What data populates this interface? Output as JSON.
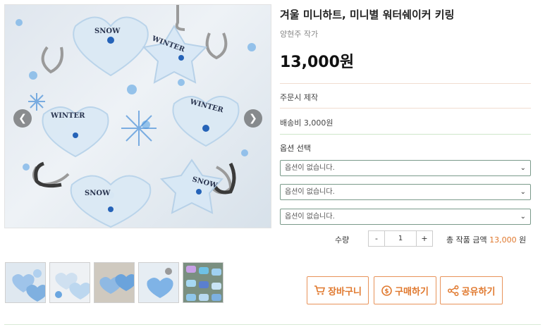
{
  "product": {
    "title": "겨울 미니하트, 미니별 워터쉐이커 키링",
    "artist": "양현주 작가",
    "price": "13,000원",
    "made_to_order": "주문시 제작",
    "shipping": "배송비 3,000원",
    "option_header": "옵션 선택",
    "options": [
      "옵션이 없습니다.",
      "옵션이 없습니다.",
      "옵션이 없습니다."
    ]
  },
  "gallery": {
    "prev_icon": "chevron-left-icon",
    "next_icon": "chevron-right-icon",
    "keychain_labels": [
      "SNOW",
      "WINTER",
      "WINTER",
      "WINTER",
      "SNOW",
      "SNOW"
    ],
    "thumbnail_count": 5
  },
  "quantity": {
    "label": "수량",
    "minus": "-",
    "value": "1",
    "plus": "+"
  },
  "total": {
    "label": "총 작품 금액",
    "amount": "13,000",
    "unit": "원"
  },
  "actions": {
    "cart": "장바구니",
    "buy": "구매하기",
    "share": "공유하기"
  },
  "colors": {
    "accent": "#e0782d",
    "border_accent": "#e8935a"
  }
}
